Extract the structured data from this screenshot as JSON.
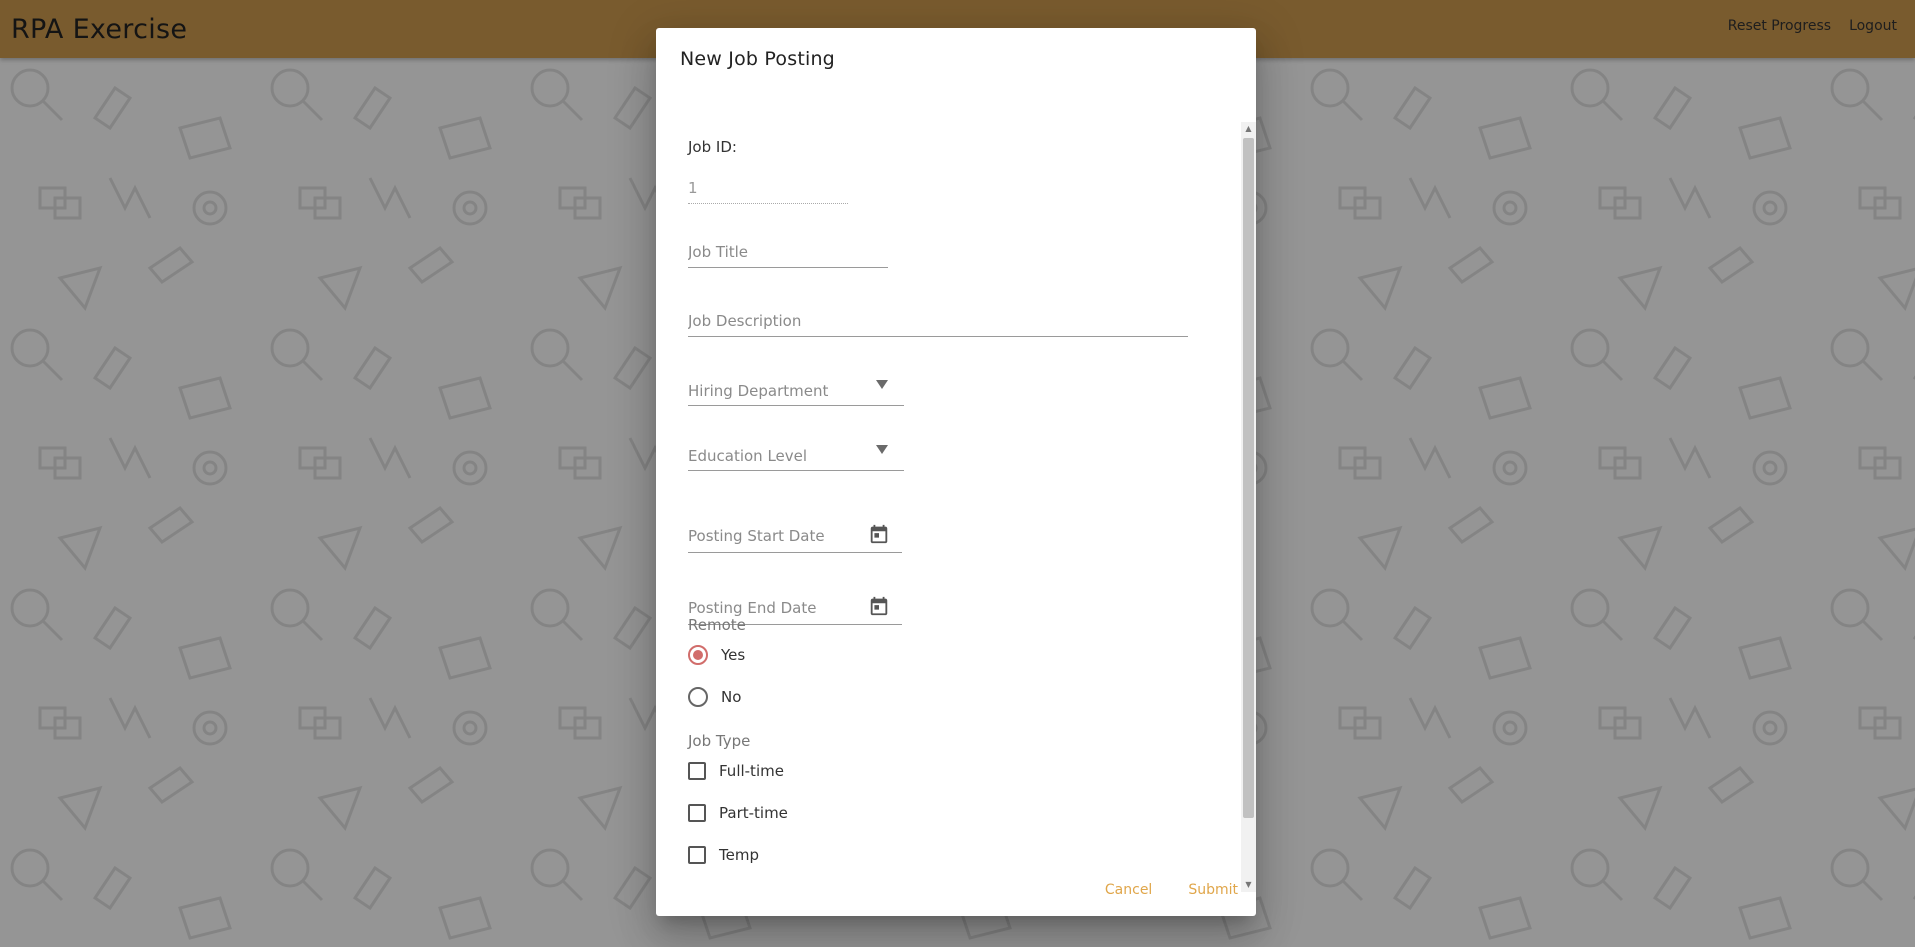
{
  "app": {
    "brand": "RPA Exercise",
    "nav": {
      "reset": "Reset Progress",
      "logout": "Logout"
    },
    "colors": {
      "header": "#a87e40",
      "accent": "#d16d6b",
      "action": "#e0a64a"
    }
  },
  "dialog": {
    "title": "New Job Posting",
    "fields": {
      "job_id_label": "Job ID:",
      "job_id_value": "1",
      "job_title_placeholder": "Job Title",
      "job_description_placeholder": "Job Description",
      "hiring_department": "Hiring Department",
      "education_level": "Education Level",
      "posting_start_date": "Posting Start Date",
      "posting_end_date": "Posting End Date"
    },
    "remote": {
      "label": "Remote",
      "options": [
        {
          "label": "Yes",
          "checked": true
        },
        {
          "label": "No",
          "checked": false
        }
      ]
    },
    "job_type": {
      "label": "Job Type",
      "options": [
        {
          "label": "Full-time",
          "checked": false
        },
        {
          "label": "Part-time",
          "checked": false
        },
        {
          "label": "Temp",
          "checked": false
        }
      ]
    },
    "actions": {
      "cancel": "Cancel",
      "submit": "Submit"
    }
  }
}
